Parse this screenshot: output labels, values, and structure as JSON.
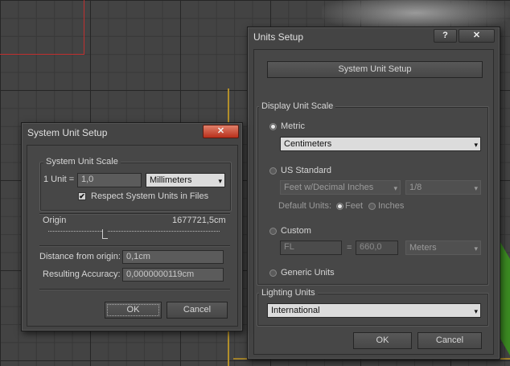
{
  "system_unit_dialog": {
    "title": "System Unit Setup",
    "close_glyph": "✕",
    "group_label": "System Unit Scale",
    "one_unit_label": "1 Unit =",
    "one_unit_value": "1,0",
    "unit_select": "Millimeters",
    "respect_label": "Respect System Units in Files",
    "respect_checked": true,
    "origin_label": "Origin",
    "origin_value": "1677721,5cm",
    "distance_label": "Distance from origin:",
    "distance_value": "0,1cm",
    "accuracy_label": "Resulting Accuracy:",
    "accuracy_value": "0,0000000119cm",
    "ok_label": "OK",
    "cancel_label": "Cancel"
  },
  "units_setup_dialog": {
    "title": "Units Setup",
    "help_glyph": "?",
    "close_glyph": "✕",
    "system_unit_setup_button": "System Unit Setup",
    "display_group_label": "Display Unit Scale",
    "metric_label": "Metric",
    "metric_select": "Centimeters",
    "us_label": "US Standard",
    "us_select": "Feet w/Decimal Inches",
    "us_fraction_select": "1/8",
    "default_units_label": "Default Units:",
    "feet_label": "Feet",
    "inches_label": "Inches",
    "custom_label": "Custom",
    "custom_name": "FL",
    "custom_equals": "=",
    "custom_value": "660,0",
    "custom_unit_select": "Meters",
    "generic_label": "Generic Units",
    "lighting_group_label": "Lighting Units",
    "lighting_select": "International",
    "ok_label": "OK",
    "cancel_label": "Cancel"
  },
  "colors": {
    "dialog_bg": "#444444",
    "viewport_bg": "#434343",
    "close_button": "#b8301c"
  },
  "icons": {
    "dropdown": "▾",
    "checkmark": "✔"
  }
}
